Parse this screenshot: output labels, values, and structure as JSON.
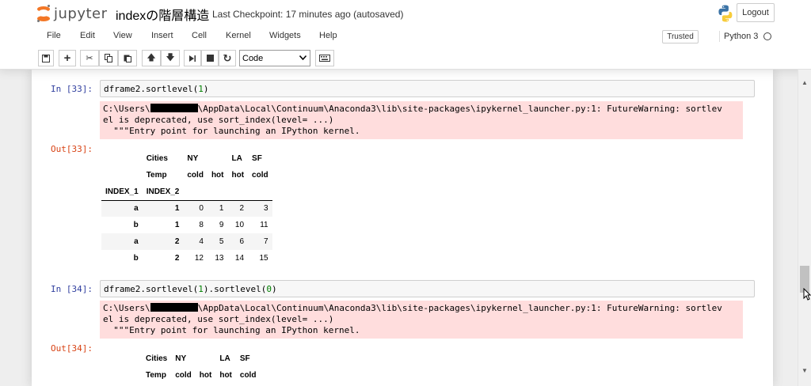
{
  "header": {
    "logo_text": "jupyter",
    "notebook_name": "indexの階層構造",
    "checkpoint": "Last Checkpoint: 17 minutes ago (autosaved)",
    "logout_label": "Logout"
  },
  "menu": {
    "items": [
      "File",
      "Edit",
      "View",
      "Insert",
      "Cell",
      "Kernel",
      "Widgets",
      "Help"
    ],
    "trusted_label": "Trusted",
    "kernel_name": "Python 3"
  },
  "toolbar": {
    "cell_type": "Code"
  },
  "cells": [
    {
      "in_prompt": "In [33]:",
      "code_prefix": "dframe2.sortlevel(",
      "code_arg": "1",
      "code_suffix": ")",
      "stderr": {
        "line1_prefix": "C:\\Users\\",
        "line1_suffix": "\\AppData\\Local\\Continuum\\Anaconda3\\lib\\site-packages\\ipykernel_launcher.py:1: FutureWarning: sortlev",
        "line2": "el is deprecated, use sort_index(level= ...)",
        "line3": "  \"\"\"Entry point for launching an IPython kernel."
      },
      "out_prompt": "Out[33]:",
      "table": {
        "header_row1": [
          "",
          "Cities",
          "NY",
          "",
          "LA",
          "SF"
        ],
        "header_row2": [
          "",
          "Temp",
          "cold",
          "hot",
          "hot",
          "cold"
        ],
        "index_names": [
          "INDEX_1",
          "INDEX_2"
        ],
        "rows": [
          {
            "i1": "a",
            "i2": "1",
            "v": [
              "0",
              "1",
              "2",
              "3"
            ]
          },
          {
            "i1": "b",
            "i2": "1",
            "v": [
              "8",
              "9",
              "10",
              "11"
            ]
          },
          {
            "i1": "a",
            "i2": "2",
            "v": [
              "4",
              "5",
              "6",
              "7"
            ]
          },
          {
            "i1": "b",
            "i2": "2",
            "v": [
              "12",
              "13",
              "14",
              "15"
            ]
          }
        ]
      }
    },
    {
      "in_prompt": "In [34]:",
      "code_prefix": "dframe2.sortlevel(",
      "code_arg": "1",
      "code_mid": ").sortlevel(",
      "code_arg2": "0",
      "code_suffix": ")",
      "stderr": {
        "line1_prefix": "C:\\Users\\",
        "line1_suffix": "\\AppData\\Local\\Continuum\\Anaconda3\\lib\\site-packages\\ipykernel_launcher.py:1: FutureWarning: sortlev",
        "line2": "el is deprecated, use sort_index(level= ...)",
        "line3": "  \"\"\"Entry point for launching an IPython kernel."
      },
      "out_prompt": "Out[34]:",
      "table": {
        "header_row1": [
          "",
          "Cities",
          "NY",
          "",
          "LA",
          "SF"
        ],
        "header_row2": [
          "",
          "Temp",
          "cold",
          "hot",
          "hot",
          "cold"
        ]
      }
    }
  ]
}
